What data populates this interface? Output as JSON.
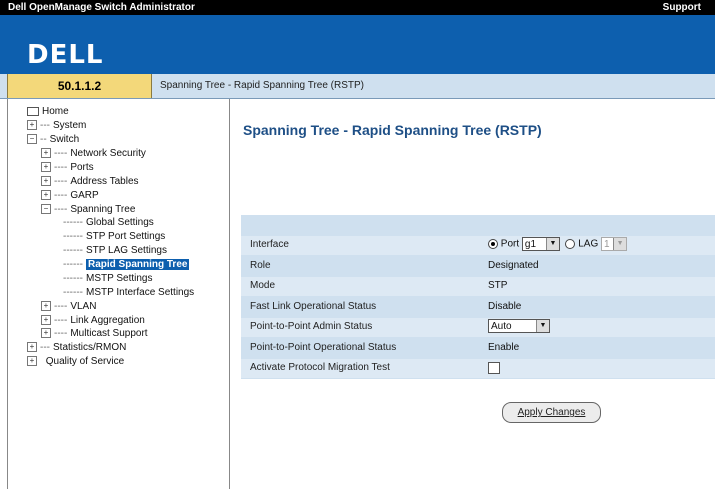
{
  "header": {
    "app_title": "Dell OpenManage Switch Administrator",
    "support_link": "Support",
    "logo": "DELL"
  },
  "ipbar": {
    "ip": "50.1.1.2",
    "breadcrumb": "Spanning Tree - Rapid Spanning Tree (RSTP)"
  },
  "tree": {
    "root": "Home",
    "system": "System",
    "switch": "Switch",
    "network_security": "Network Security",
    "ports": "Ports",
    "address_tables": "Address Tables",
    "garp": "GARP",
    "spanning_tree": "Spanning Tree",
    "global_settings": "Global Settings",
    "stp_port_settings": "STP Port Settings",
    "stp_lag_settings": "STP LAG Settings",
    "rapid_spanning_tree": "Rapid Spanning Tree",
    "mstp_settings": "MSTP Settings",
    "mstp_interface_settings": "MSTP Interface Settings",
    "vlan": "VLAN",
    "link_aggregation": "Link Aggregation",
    "multicast_support": "Multicast Support",
    "statistics_rmon": "Statistics/RMON",
    "quality_of_service": "Quality of Service"
  },
  "main": {
    "title": "Spanning Tree - Rapid Spanning Tree (RSTP)",
    "fields": {
      "interface_label": "Interface",
      "port_label": "Port",
      "port_value": "g1",
      "lag_label": "LAG",
      "lag_value": "1",
      "role_label": "Role",
      "role_value": "Designated",
      "mode_label": "Mode",
      "mode_value": "STP",
      "fast_link_label": "Fast Link Operational Status",
      "fast_link_value": "Disable",
      "p2p_admin_label": "Point-to-Point Admin Status",
      "p2p_admin_value": "Auto",
      "p2p_oper_label": "Point-to-Point Operational Status",
      "p2p_oper_value": "Enable",
      "activate_label": "Activate Protocol Migration Test"
    },
    "apply_label": "Apply Changes"
  },
  "colors": {
    "banner": "#0d5fae",
    "ip_cell": "#f3d87a",
    "panel": "#cfe0ef",
    "selected": "#0d5fae"
  }
}
